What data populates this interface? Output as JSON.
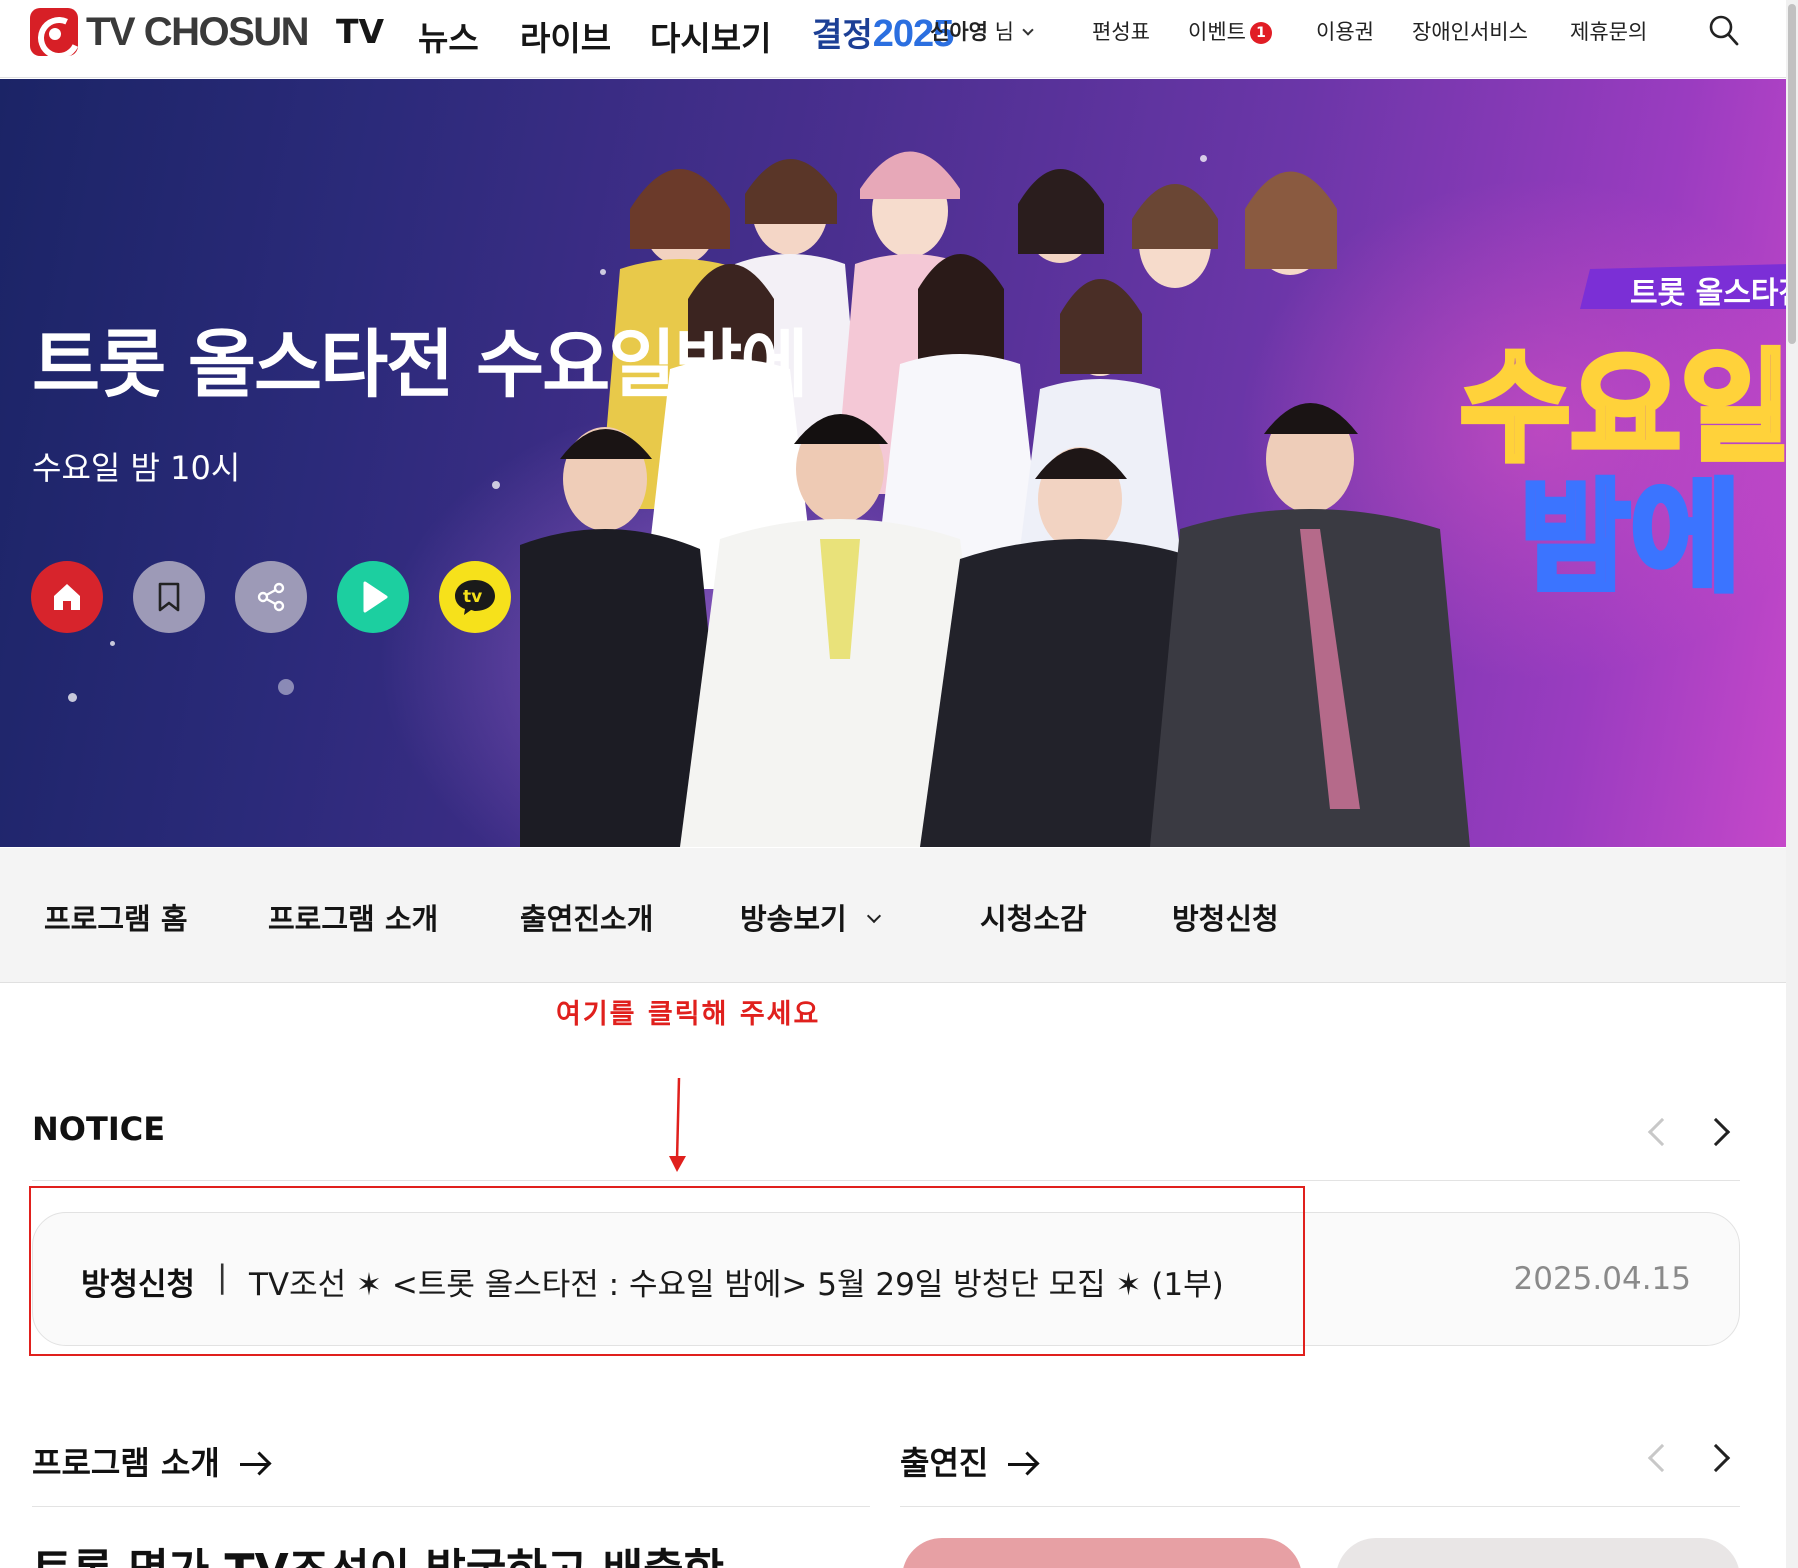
{
  "header": {
    "logo_text": "TV CHOSUN",
    "gnb": [
      "TV",
      "뉴스",
      "라이브",
      "다시보기"
    ],
    "election_label": "결정",
    "election_year": "2025",
    "user_name": "신아영",
    "user_suffix": "님",
    "util": {
      "schedule": "편성표",
      "event": "이벤트",
      "event_badge": "1",
      "pass": "이용권",
      "accessibility": "장애인서비스",
      "partnership": "제휴문의"
    }
  },
  "hero": {
    "title": "트롯 올스타전 수요일밤에",
    "subtitle": "수요일 밤 10시",
    "logo_tag": "트롯 올스타전",
    "logo_line1": "수요일",
    "logo_line2": "밤에"
  },
  "subnav": [
    "프로그램 홈",
    "프로그램 소개",
    "출연진소개",
    "방송보기",
    "시청소감",
    "방청신청"
  ],
  "annotation": {
    "text": "여기를 클릭해 주세요"
  },
  "notice": {
    "heading": "NOTICE",
    "category": "방청신청",
    "separator": "|",
    "title": "TV조선 ✶ <트롯 올스타전 : 수요일 밤에> 5월 29일 방청단 모집 ✶ (1부)",
    "date": "2025.04.15"
  },
  "program_intro": {
    "heading": "프로그램 소개",
    "text_partial": "트롯 명가 TV조선이 발굴하고 배출한"
  },
  "cast_section": {
    "heading": "출연진"
  },
  "colors": {
    "brand_red": "#d71f26",
    "annotation_red": "#e0201d",
    "hero_gradient_start": "#1b2466",
    "hero_gradient_end": "#c548c9"
  }
}
